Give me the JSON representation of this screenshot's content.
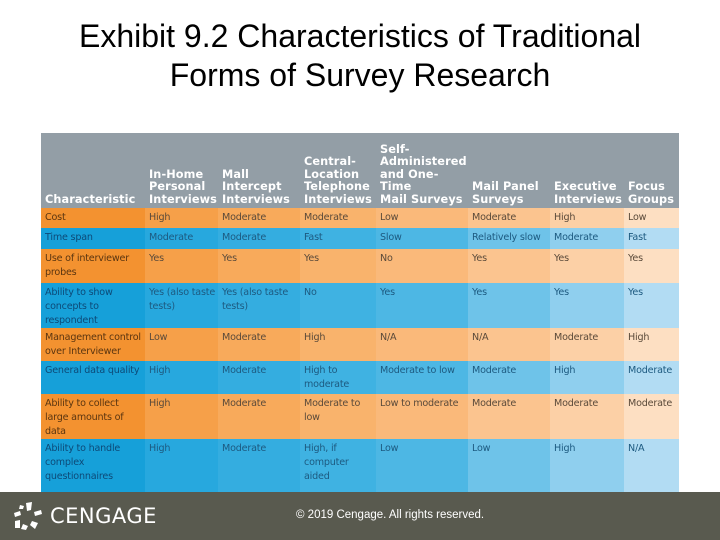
{
  "slide": {
    "title_line1": "Exhibit 9.2 Characteristics of Traditional",
    "title_line2": "Forms of Survey Research"
  },
  "table": {
    "headers": [
      [
        "Characteristic"
      ],
      [
        "In-Home",
        "Personal",
        "Interviews"
      ],
      [
        "Mall",
        "Intercept",
        "Interviews"
      ],
      [
        "Central-",
        "Location",
        "Telephone",
        "Interviews"
      ],
      [
        "Self-",
        "Administered",
        "and One-Time",
        "Mail Surveys"
      ],
      [
        "Mail Panel",
        "Surveys"
      ],
      [
        "Executive",
        "Interviews"
      ],
      [
        "Focus",
        "Groups"
      ]
    ],
    "rows": [
      {
        "color": "orange",
        "cells": [
          "Cost",
          "High",
          "Moderate",
          "Moderate",
          "Low",
          "Moderate",
          "High",
          "Low"
        ]
      },
      {
        "color": "blue",
        "cells": [
          "Time span",
          "Moderate",
          "Moderate",
          "Fast",
          "Slow",
          "Relatively slow",
          "Moderate",
          "Fast"
        ]
      },
      {
        "color": "orange",
        "cells": [
          "Use of interviewer probes",
          "Yes",
          "Yes",
          "Yes",
          "No",
          "Yes",
          "Yes",
          "Yes"
        ]
      },
      {
        "color": "blue",
        "cells": [
          "Ability to show concepts to respondent",
          "Yes (also taste tests)",
          "Yes (also taste tests)",
          "No",
          "Yes",
          "Yes",
          "Yes",
          "Yes"
        ]
      },
      {
        "color": "orange",
        "cells": [
          "Management control over Interviewer",
          "Low",
          "Moderate",
          "High",
          "N/A",
          "N/A",
          "Moderate",
          "High"
        ]
      },
      {
        "color": "blue",
        "cells": [
          "General data quality",
          "High",
          "Moderate",
          "High to moderate",
          "Moderate to low",
          "Moderate",
          "High",
          "Moderate"
        ]
      },
      {
        "color": "orange",
        "cells": [
          "Ability to collect large amounts of data",
          "High",
          "Moderate",
          "Moderate to low",
          "Low to moderate",
          "Moderate",
          "Moderate",
          "Moderate"
        ]
      },
      {
        "color": "blue",
        "cells": [
          "Ability to handle complex questionnaires",
          "High",
          "Moderate",
          "High, if computer aided",
          "Low",
          "Low",
          "High",
          "N/A"
        ]
      }
    ]
  },
  "footer": {
    "logo_icon": "cengage-logo-icon",
    "logo_text": "CENGAGE",
    "copyright": "© 2019 Cengage. All rights reserved."
  },
  "colors": {
    "header_gray": "#939ea6",
    "orange": "#f39230",
    "blue": "#16a0d9",
    "footer_bg": "#595a4f"
  }
}
